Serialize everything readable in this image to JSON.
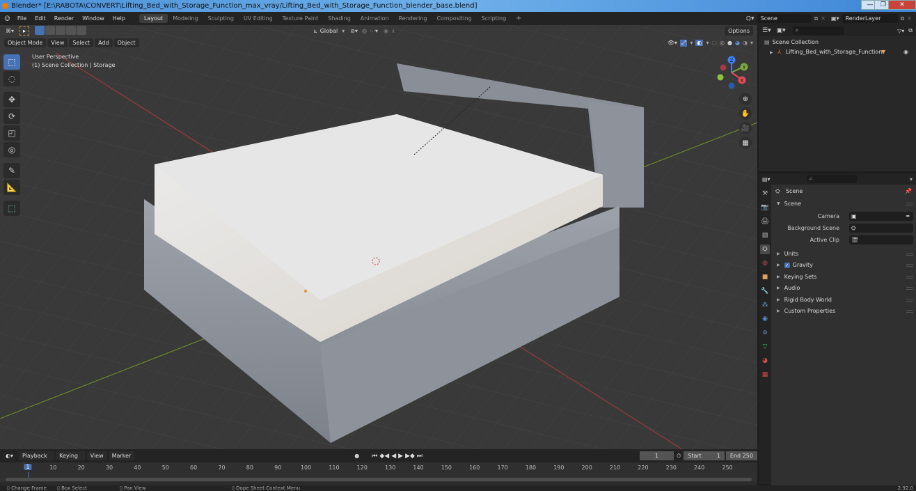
{
  "window": {
    "title": "Blender* [E:\\RABOTA\\CONVERT\\Lifting_Bed_with_Storage_Function_max_vray/Lifting_Bed_with_Storage_Function_blender_base.blend]",
    "minimize": "—",
    "maximize": "❐",
    "close": "✕"
  },
  "menu": [
    "File",
    "Edit",
    "Render",
    "Window",
    "Help"
  ],
  "workspaces": [
    "Layout",
    "Modeling",
    "Sculpting",
    "UV Editing",
    "Texture Paint",
    "Shading",
    "Animation",
    "Rendering",
    "Compositing",
    "Scripting"
  ],
  "active_workspace": "Layout",
  "add_workspace": "+",
  "scene": {
    "label": "Scene",
    "render_layer": "RenderLayer"
  },
  "viewport": {
    "mode": "Object Mode",
    "menus": [
      "View",
      "Select",
      "Add",
      "Object"
    ],
    "transform_orientation": "Global",
    "options": "Options",
    "perspective": "User Perspective",
    "collection": "(1) Scene Collection | Storage",
    "gizmo": {
      "z": "Z",
      "y": "Y",
      "x": "X"
    }
  },
  "tools": [
    "select-box",
    "cursor",
    "move",
    "rotate",
    "scale",
    "transform",
    "annotate",
    "measure",
    "add-cube"
  ],
  "outliner": {
    "root": "Scene Collection",
    "items": [
      {
        "name": "Lifting_Bed_with_Storage_Function",
        "visible": true
      }
    ]
  },
  "properties": {
    "title": "Scene",
    "section": "Scene",
    "fields": [
      {
        "label": "Camera",
        "value": ""
      },
      {
        "label": "Background Scene",
        "value": ""
      },
      {
        "label": "Active Clip",
        "value": ""
      }
    ],
    "panels": [
      {
        "label": "Units",
        "checkbox": false
      },
      {
        "label": "Gravity",
        "checkbox": true
      },
      {
        "label": "Keying Sets",
        "checkbox": false
      },
      {
        "label": "Audio",
        "checkbox": false
      },
      {
        "label": "Rigid Body World",
        "checkbox": false
      },
      {
        "label": "Custom Properties",
        "checkbox": false
      }
    ],
    "tab_colors": [
      "#bbbbbb",
      "#bbbbbb",
      "#bbbbbb",
      "#bbbbbb",
      "#dddddd",
      "#c0445a",
      "#e0a060",
      "#5b8fd6",
      "#6ea3e0",
      "#5b8fd6",
      "#5b8fd6",
      "#2fb56a",
      "#d24a4a",
      "#d24a4a"
    ]
  },
  "timeline": {
    "menus": [
      "Playback",
      "Keying",
      "View",
      "Marker"
    ],
    "current_frame": "1",
    "start_label": "Start",
    "start": "1",
    "end_label": "End",
    "end": "250",
    "ticks": [
      "10",
      "20",
      "30",
      "40",
      "50",
      "60",
      "70",
      "80",
      "90",
      "100",
      "110",
      "120",
      "130",
      "140",
      "150",
      "160",
      "170",
      "180",
      "190",
      "200",
      "210",
      "220",
      "230",
      "240",
      "250"
    ],
    "playhead": "1"
  },
  "status": {
    "items": [
      "Change Frame",
      "Box Select",
      "Pan View",
      "Dope Sheet Context Menu"
    ],
    "version": "2.92.0"
  }
}
